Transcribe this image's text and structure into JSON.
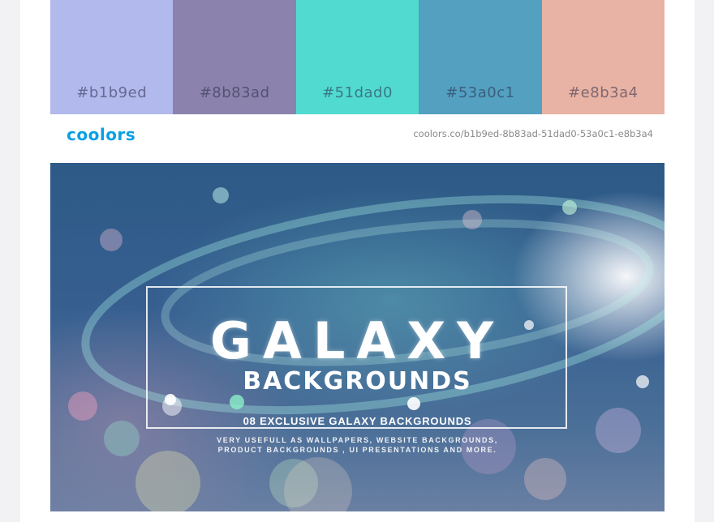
{
  "palette": {
    "swatches": [
      {
        "hex": "#b1b9ed",
        "label": "#b1b9ed"
      },
      {
        "hex": "#8b83ad",
        "label": "#8b83ad"
      },
      {
        "hex": "#51dad0",
        "label": "#51dad0"
      },
      {
        "hex": "#53a0c1",
        "label": "#53a0c1"
      },
      {
        "hex": "#e8b3a4",
        "label": "#e8b3a4"
      }
    ],
    "logo": "coolors",
    "url": "coolors.co/b1b9ed-8b83ad-51dad0-53a0c1-e8b3a4"
  },
  "hero": {
    "title": "GALAXY",
    "subtitle": "BACKGROUNDS",
    "tagline": "08 EXCLUSIVE GALAXY BACKGROUNDS",
    "description_line1": "VERY USEFULL AS WALLPAPERS, WEBSITE BACKGROUNDS,",
    "description_line2": "PRODUCT BACKGROUNDS , UI PRESENTATIONS AND MORE."
  }
}
